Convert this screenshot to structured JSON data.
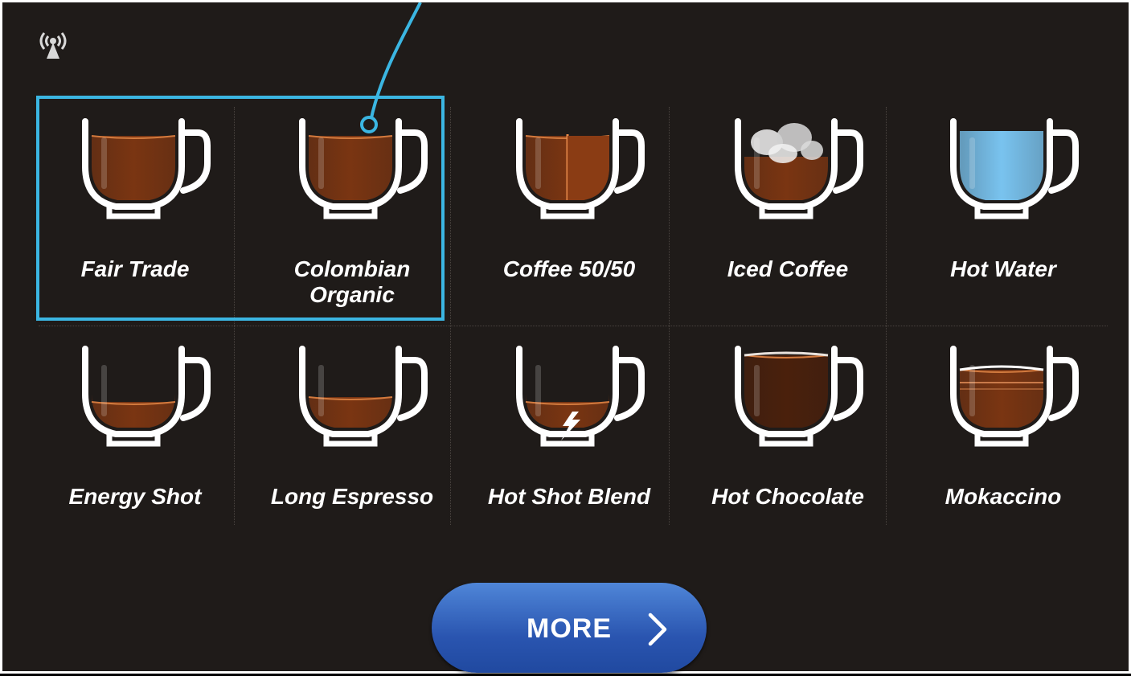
{
  "drinks": [
    {
      "label": "Fair Trade",
      "style": "full"
    },
    {
      "label": "Colombian Organic",
      "style": "full"
    },
    {
      "label": "Coffee 50/50",
      "style": "half"
    },
    {
      "label": "Iced Coffee",
      "style": "iced"
    },
    {
      "label": "Hot Water",
      "style": "water"
    },
    {
      "label": "Energy Shot",
      "style": "low"
    },
    {
      "label": "Long Espresso",
      "style": "medium"
    },
    {
      "label": "Hot Shot Blend",
      "style": "bolt"
    },
    {
      "label": "Hot Chocolate",
      "style": "dark"
    },
    {
      "label": "Mokaccino",
      "style": "layered"
    }
  ],
  "more_button": {
    "label": "MORE",
    "icon": "chevron-right-icon"
  },
  "status": {
    "icon": "signal-antenna-icon"
  },
  "highlight": {
    "color": "#3bb6e2"
  },
  "colors": {
    "background": "#1f1b19",
    "coffee": "#7a3512",
    "coffee_dark": "#4a200c",
    "water": "#79c3ef",
    "button": "#2a55b0"
  }
}
